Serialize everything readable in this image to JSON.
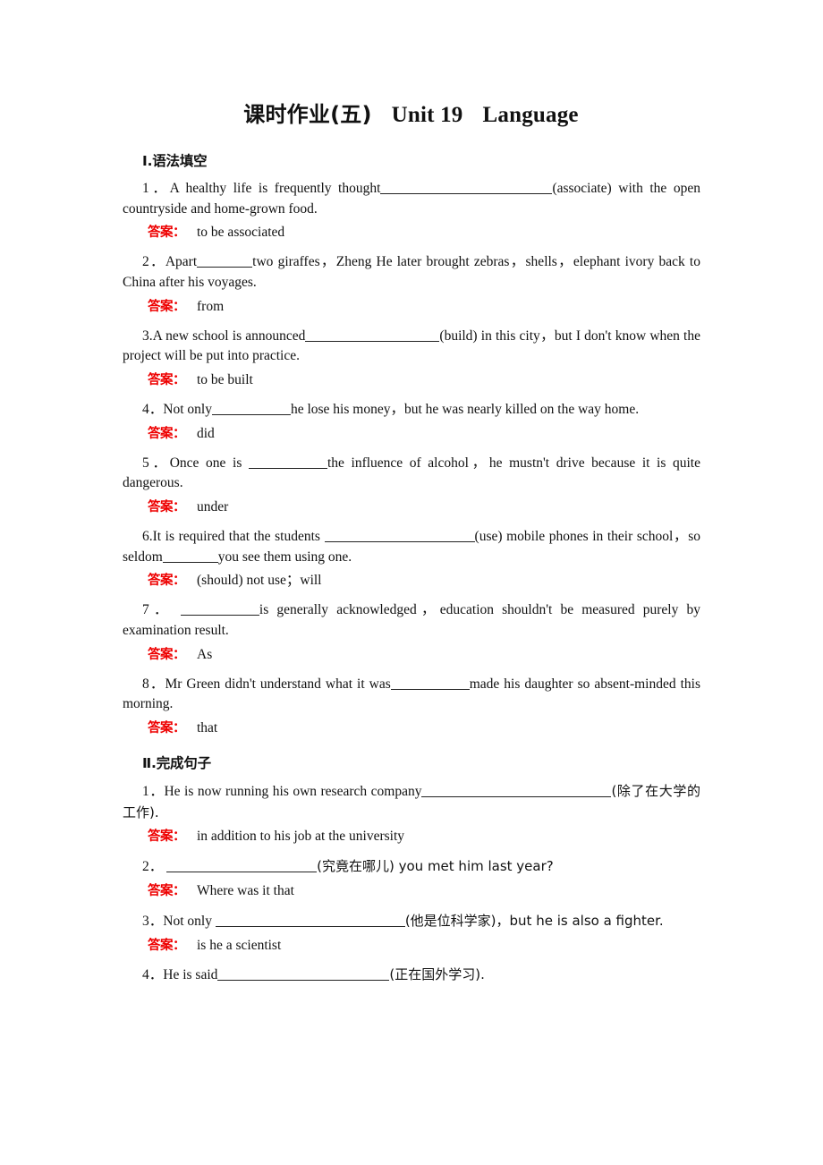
{
  "document": {
    "title_cn": "课时作业(五)",
    "title_unit": "Unit 19",
    "title_topic": "Language"
  },
  "sections": [
    {
      "heading": "Ⅰ.语法填空",
      "answer_label": "答案：",
      "questions": [
        {
          "number": "1．",
          "text_a": "A healthy life is frequently thought",
          "blank": "b-3xl",
          "text_b": "(associate) with the open countryside and home-grown food.",
          "answer": "to be associated"
        },
        {
          "number": "2．",
          "text_a": "Apart",
          "blank": "b-s",
          "text_b": "two giraffes，Zheng He later brought zebras，shells，elephant ivory back to China after his voyages.",
          "answer": "from"
        },
        {
          "number": "3.",
          "text_a": "A new school is announced",
          "blank": "b-xl",
          "text_b": "(build) in this city，but I don't know when the project will be put into practice.",
          "answer": "to be built"
        },
        {
          "number": "4．",
          "text_a": "Not only",
          "blank": "b-m",
          "text_b": "he lose his money，but he was nearly killed on the way home.",
          "answer": "did"
        },
        {
          "number": "5．",
          "text_a": "Once one is ",
          "blank": "b-m",
          "text_b": "the influence of alcohol，he mustn't drive because it is quite dangerous.",
          "answer": "under"
        },
        {
          "number": "6.",
          "text_a": "It is required that the students ",
          "blank": "b-xxl",
          "text_b": "(use) mobile phones in their school，so seldom",
          "blank2": "b-s",
          "text_c": "you see them using one.",
          "answer": "(should) not use；will"
        },
        {
          "number": "7．",
          "text_a": " ",
          "blank": "b-m",
          "text_b": "is generally acknowledged，education shouldn't be measured purely by examination result.",
          "answer": "As"
        },
        {
          "number": "8．",
          "text_a": "Mr Green didn't understand what it was",
          "blank": "b-m",
          "text_b": "made his daughter so absent-minded this morning.",
          "answer": "that"
        }
      ]
    },
    {
      "heading": "Ⅱ.完成句子",
      "answer_label": "答案：",
      "questions": [
        {
          "number": "1．",
          "text_a": "He is now running his own research company",
          "blank": "b-4xl",
          "text_b": "(除了在大学的工作).",
          "answer": "in addition to his job at the university"
        },
        {
          "number": "2．",
          "text_a": " ",
          "blank": "b-xxl",
          "text_b": "(究竟在哪儿) you met him last year?",
          "answer": "Where was it that"
        },
        {
          "number": "3．",
          "text_a": "Not only ",
          "blank": "b-4xl",
          "text_b": "(他是位科学家)，but he is also a fighter.",
          "answer": "is he a scientist"
        },
        {
          "number": "4．",
          "text_a": "He is said",
          "blank": "b-3xl",
          "text_b": "(正在国外学习).",
          "answer": ""
        }
      ]
    }
  ]
}
